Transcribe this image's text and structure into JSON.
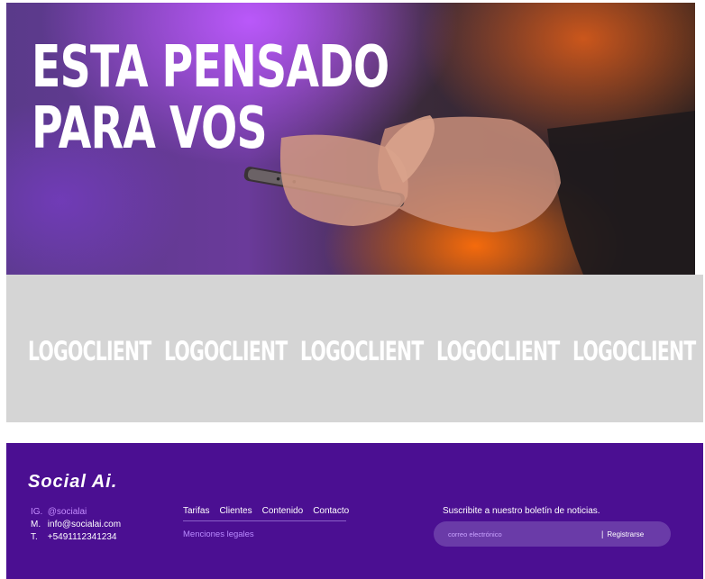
{
  "hero": {
    "title": "ESTA PENSADO\nPARA VOS"
  },
  "logos": [
    "LOGOCLIENT",
    "LOGOCLIENT",
    "LOGOCLIENT",
    "LOGOCLIENT",
    "LOGOCLIENT"
  ],
  "footer": {
    "brand": "Social Ai.",
    "contact": {
      "ig_label": "IG.",
      "ig_value": "@socialai",
      "mail_label": "M.",
      "mail_value": "info@socialai.com",
      "tel_label": "T.",
      "tel_value": "+5491112341234"
    },
    "nav": [
      "Tarifas",
      "Clientes",
      "Contenido",
      "Contacto"
    ],
    "legal": "Menciones legales",
    "newsletter": {
      "title": "Suscribite a nuestro boletín de noticias.",
      "placeholder": "correo electrónico",
      "separator": "|",
      "button": "Registrarse"
    }
  },
  "colors": {
    "footer_bg": "#4b0f92",
    "accent": "#c48cff",
    "logos_bg": "#d5d5d5"
  }
}
